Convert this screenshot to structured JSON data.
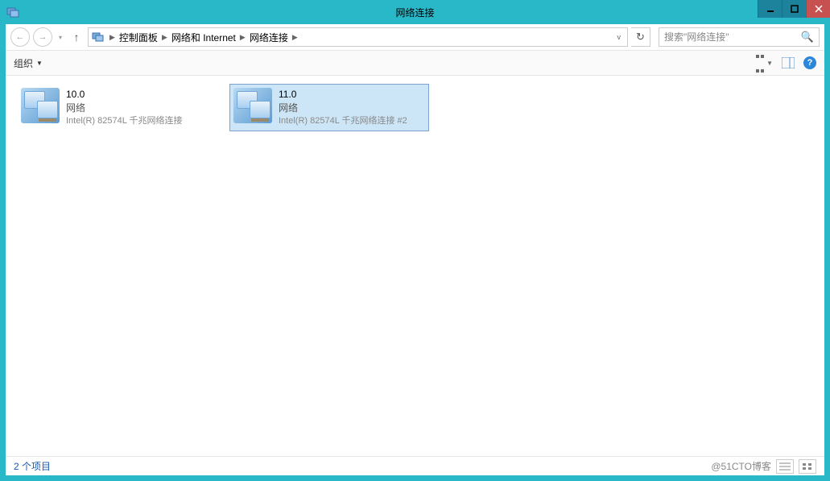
{
  "titlebar": {
    "title": "网络连接"
  },
  "breadcrumbs": {
    "items": [
      "控制面板",
      "网络和 Internet",
      "网络连接"
    ]
  },
  "search": {
    "placeholder": "搜索\"网络连接\""
  },
  "toolbar": {
    "organize_label": "组织"
  },
  "adapters": [
    {
      "name": "10.0",
      "status": "网络",
      "device": "Intel(R) 82574L 千兆网络连接",
      "selected": false
    },
    {
      "name": "11.0",
      "status": "网络",
      "device": "Intel(R) 82574L 千兆网络连接 #2",
      "selected": true
    }
  ],
  "statusbar": {
    "item_count_text": "2 个项目",
    "watermark": "@51CTO博客"
  }
}
